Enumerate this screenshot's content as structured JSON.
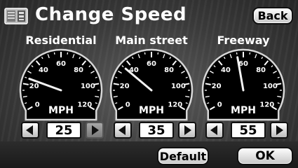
{
  "header": {
    "title": "Change Speed",
    "back_label": "Back"
  },
  "gauges": [
    {
      "label": "Residential",
      "value": "25",
      "speed": 25,
      "decrease_enabled": true,
      "increase_enabled": false
    },
    {
      "label": "Main street",
      "value": "35",
      "speed": 35,
      "decrease_enabled": true,
      "increase_enabled": true
    },
    {
      "label": "Freeway",
      "value": "55",
      "speed": 55,
      "decrease_enabled": true,
      "increase_enabled": true
    }
  ],
  "dial": {
    "unit": "MPH",
    "ticks": [
      "0",
      "20",
      "40",
      "60",
      "80",
      "100",
      "120"
    ],
    "min": 0,
    "max": 120
  },
  "footer": {
    "default_label": "Default",
    "ok_label": "OK"
  },
  "icons": {
    "menu": "menu-list-icon",
    "decrease": "left-arrow-icon",
    "increase": "right-arrow-icon"
  },
  "colors": {
    "needle": "#f2f2f2",
    "face": "#000000",
    "button": "#e6e6e6",
    "disabled_button": "#8c8c8c"
  }
}
